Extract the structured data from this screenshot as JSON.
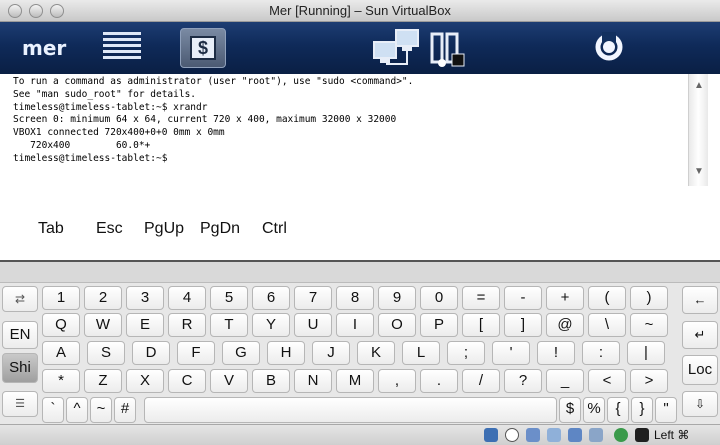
{
  "window": {
    "title": "Mer [Running] – Sun VirtualBox"
  },
  "toolbar": {
    "logo_text": "mer",
    "icons": [
      "menu-lines-icon",
      "terminal-icon",
      "network-icon",
      "documents-icon",
      "power-icon"
    ]
  },
  "terminal": {
    "lines": [
      "To run a command as administrator (user \"root\"), use \"sudo <command>\".",
      "See \"man sudo_root\" for details.",
      "",
      "timeless@timeless-tablet:~$ xrandr",
      "Screen 0: minimum 64 x 64, current 720 x 400, maximum 32000 x 32000",
      "VBOX1 connected 720x400+0+0 0mm x 0mm",
      "   720x400        60.0*+",
      "timeless@timeless-tablet:~$"
    ]
  },
  "special_keys": [
    "Tab",
    "Esc",
    "PgUp",
    "PgDn",
    "Ctrl"
  ],
  "keyboard": {
    "row1": [
      "1",
      "2",
      "3",
      "4",
      "5",
      "6",
      "7",
      "8",
      "9",
      "0",
      "=",
      "-",
      "+",
      "(",
      ")"
    ],
    "row2": [
      "Q",
      "W",
      "E",
      "R",
      "T",
      "Y",
      "U",
      "I",
      "O",
      "P",
      "[",
      "]",
      "@",
      "\\",
      "~"
    ],
    "row3": [
      "A",
      "S",
      "D",
      "F",
      "G",
      "H",
      "J",
      "K",
      "L",
      ";",
      "'",
      "!",
      ":",
      "|"
    ],
    "row4": [
      "*",
      "Z",
      "X",
      "C",
      "V",
      "B",
      "N",
      "M",
      ",",
      ".",
      "/",
      "?",
      "_",
      "<",
      ">"
    ],
    "row5_left": [
      "`",
      "^",
      "~",
      "#"
    ],
    "row5_right": [
      "$",
      "%",
      "{",
      "}",
      "\""
    ],
    "left_column": {
      "swap": "⇄",
      "lang": "EN",
      "shift": "Shi",
      "menu": "☰"
    },
    "right_column": {
      "backspace": "←",
      "enter": "↵",
      "lock": "Loc",
      "down": "⇩"
    }
  },
  "statusbar": {
    "host_key": "Left ⌘"
  }
}
